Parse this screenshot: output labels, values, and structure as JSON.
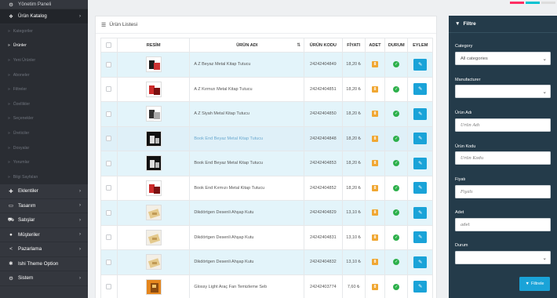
{
  "sidebar": {
    "items": [
      {
        "icon": "dashboard-icon",
        "glyph": "⚙",
        "label": "Yönetim Paneli"
      },
      {
        "icon": "tag-icon",
        "glyph": "❖",
        "label": "Ürün Katalog",
        "chevron": "›"
      },
      {
        "icon": "puzzle-icon",
        "glyph": "✚",
        "label": "Eklentiler",
        "chevron": "›"
      },
      {
        "icon": "desktop-icon",
        "glyph": "▭",
        "label": "Tasarım",
        "chevron": "›"
      },
      {
        "icon": "cart-icon",
        "glyph": "⛟",
        "label": "Satışlar",
        "chevron": "›"
      },
      {
        "icon": "user-icon",
        "glyph": "●",
        "label": "Müşteriler",
        "chevron": "›"
      },
      {
        "icon": "share-icon",
        "glyph": "<",
        "label": "Pazarlama",
        "chevron": "›"
      },
      {
        "icon": "cogs-icon",
        "glyph": "✱",
        "label": "Ishi Theme Option"
      },
      {
        "icon": "gear-icon",
        "glyph": "⚙",
        "label": "Sistem",
        "chevron": "›"
      }
    ],
    "submenu": [
      {
        "label": "Kategoriler"
      },
      {
        "label": "Ürünler"
      },
      {
        "label": "Yeni Ürünler"
      },
      {
        "label": "Aboneler"
      },
      {
        "label": "Filtreler"
      },
      {
        "label": "Özellikler"
      },
      {
        "label": "Seçenekler"
      },
      {
        "label": "Üreticiler"
      },
      {
        "label": "Dosyalar"
      },
      {
        "label": "Yorumlar"
      },
      {
        "label": "Bilgi Sayfaları"
      }
    ],
    "bullet": "»"
  },
  "accents": [
    "#ff2e63",
    "#00c2d1",
    "#dddddd"
  ],
  "product_list": {
    "title": "Ürün Listesi",
    "title_icon": "☰",
    "sort_glyph": "⇅",
    "columns": {
      "image": "RESİM",
      "name": "ÜRÜN ADI",
      "code": "ÜRÜN KODU",
      "price": "FİYATI",
      "qty": "ADET",
      "status": "DURUM",
      "action": "EYLEM"
    },
    "check_glyph": "✓",
    "edit_glyph": "✎",
    "rows": [
      {
        "thumb": "white",
        "name": "A Z Beyaz Metal Kitap Tutucu",
        "code": "24242404849",
        "price": "18,20 ₺",
        "qty": "8",
        "highlight": "striped"
      },
      {
        "thumb": "red",
        "name": "A Z Kırmızı Metal Kitap Tutucu",
        "code": "24242404851",
        "price": "18,20 ₺",
        "qty": "8",
        "highlight": ""
      },
      {
        "thumb": "silver",
        "name": "A Z Siyah Metal Kitap Tutucu",
        "code": "24242404850",
        "price": "18,20 ₺",
        "qty": "8",
        "highlight": "striped"
      },
      {
        "thumb": "black",
        "name": "Book End Beyaz Metal Kitap Tutucu",
        "code": "24242404848",
        "price": "18,20 ₺",
        "qty": "8",
        "highlight": "hovered",
        "link": true
      },
      {
        "thumb": "black",
        "name": "Book End Beyaz Metal Kitap Tutucu",
        "code": "24242404853",
        "price": "18,20 ₺",
        "qty": "8",
        "highlight": "striped"
      },
      {
        "thumb": "red",
        "name": "Book End Kırmızı Metal Kitap Tutucu",
        "code": "24242404852",
        "price": "18,20 ₺",
        "qty": "8",
        "highlight": ""
      },
      {
        "thumb": "box",
        "name": "Dikdörtgen Desenli Ahşap Kutu",
        "code": "24242404829",
        "price": "13,10 ₺",
        "qty": "8",
        "highlight": "striped"
      },
      {
        "thumb": "box",
        "name": "Dikdörtgen Desenli Ahşap Kutu",
        "code": "24242404831",
        "price": "13,10 ₺",
        "qty": "8",
        "highlight": ""
      },
      {
        "thumb": "box",
        "name": "Dikdörtgen Desenli Ahşap Kutu",
        "code": "24242404832",
        "price": "13,10 ₺",
        "qty": "8",
        "highlight": "striped"
      },
      {
        "thumb": "orange",
        "name": "Glossy Light Araç Fan Temizleme Seb",
        "code": "24242403774",
        "price": "7,60 ₺",
        "qty": "8",
        "highlight": ""
      }
    ]
  },
  "filter": {
    "title": "Filtre",
    "title_icon": "▼",
    "category_label": "Category",
    "category_value": "All categories",
    "manufacturer_label": "Manufacturer",
    "manufacturer_value": "",
    "name_label": "Ürün Adı",
    "name_placeholder": "Ürün Adı",
    "code_label": "Ürün Kodu",
    "code_placeholder": "Ürün Kodu",
    "price_label": "Fiyatı",
    "price_placeholder": "Fiyatı",
    "qty_label": "Adet",
    "qty_placeholder": "adet",
    "status_label": "Durum",
    "status_value": "",
    "caret": "⌄",
    "button_label": "Filtrele",
    "button_icon": "▼"
  }
}
